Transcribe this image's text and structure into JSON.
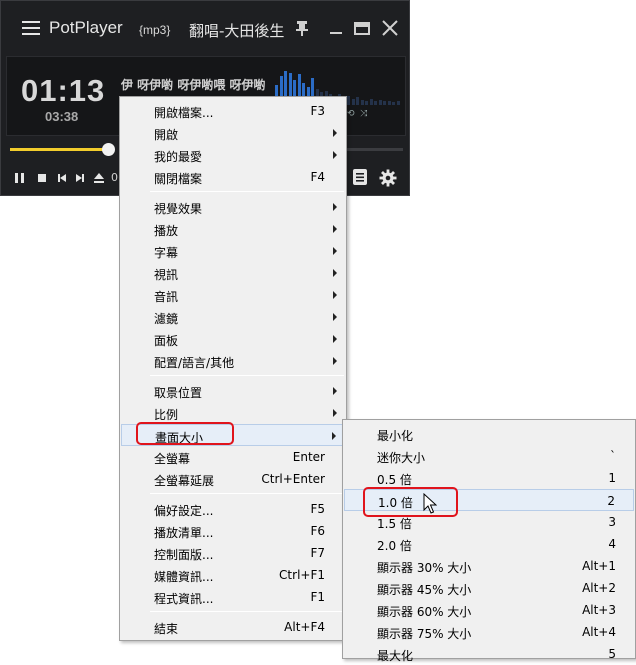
{
  "player": {
    "app_title": "PotPlayer",
    "file_format": "{mp3}",
    "file_title": "翻唱-大田後生",
    "time_current": "01:13",
    "time_total": "03:38",
    "lyrics": "伊 呀伊喲 呀伊喲喂 呀伊喲",
    "partial_text": "0(",
    "accent_color": "#f2cc2c",
    "spectrum_color": "#2b6cc6",
    "seek_progress": 0.25
  },
  "main_menu": {
    "items": [
      {
        "label": "開啟檔案...",
        "shortcut": "F3",
        "submenu": false
      },
      {
        "label": "開啟",
        "shortcut": "",
        "submenu": true
      },
      {
        "label": "我的最愛",
        "shortcut": "",
        "submenu": true
      },
      {
        "label": "關閉檔案",
        "shortcut": "F4",
        "submenu": false
      },
      {
        "sep": true
      },
      {
        "label": "視覺效果",
        "shortcut": "",
        "submenu": true
      },
      {
        "label": "播放",
        "shortcut": "",
        "submenu": true
      },
      {
        "label": "字幕",
        "shortcut": "",
        "submenu": true
      },
      {
        "label": "視訊",
        "shortcut": "",
        "submenu": true
      },
      {
        "label": "音訊",
        "shortcut": "",
        "submenu": true
      },
      {
        "label": "濾鏡",
        "shortcut": "",
        "submenu": true
      },
      {
        "label": "面板",
        "shortcut": "",
        "submenu": true
      },
      {
        "label": "配置/語言/其他",
        "shortcut": "",
        "submenu": true
      },
      {
        "sep": true
      },
      {
        "label": "取景位置",
        "shortcut": "",
        "submenu": true
      },
      {
        "label": "比例",
        "shortcut": "",
        "submenu": true
      },
      {
        "label": "畫面大小",
        "shortcut": "",
        "submenu": true,
        "highlighted": true
      },
      {
        "label": "全螢幕",
        "shortcut": "Enter",
        "submenu": false
      },
      {
        "label": "全螢幕延展",
        "shortcut": "Ctrl+Enter",
        "submenu": false
      },
      {
        "sep": true
      },
      {
        "label": "偏好設定...",
        "shortcut": "F5",
        "submenu": false
      },
      {
        "label": "播放清單...",
        "shortcut": "F6",
        "submenu": false
      },
      {
        "label": "控制面版...",
        "shortcut": "F7",
        "submenu": false
      },
      {
        "label": "媒體資訊...",
        "shortcut": "Ctrl+F1",
        "submenu": false
      },
      {
        "label": "程式資訊...",
        "shortcut": "F1",
        "submenu": false
      },
      {
        "sep": true
      },
      {
        "label": "結束",
        "shortcut": "Alt+F4",
        "submenu": false
      }
    ]
  },
  "size_menu": {
    "items": [
      {
        "label": "最小化",
        "shortcut": ""
      },
      {
        "label": "迷你大小",
        "shortcut": "`"
      },
      {
        "label": "0.5 倍",
        "shortcut": "1"
      },
      {
        "label": "1.0 倍",
        "shortcut": "2",
        "highlighted": true
      },
      {
        "label": "1.5 倍",
        "shortcut": "3"
      },
      {
        "label": "2.0 倍",
        "shortcut": "4"
      },
      {
        "label": "顯示器 30% 大小",
        "shortcut": "Alt+1"
      },
      {
        "label": "顯示器 45% 大小",
        "shortcut": "Alt+2"
      },
      {
        "label": "顯示器 60% 大小",
        "shortcut": "Alt+3"
      },
      {
        "label": "顯示器 75% 大小",
        "shortcut": "Alt+4"
      },
      {
        "label": "最大化",
        "shortcut": "5"
      }
    ]
  },
  "icons": {
    "menu": "hamburger-menu-icon",
    "pin": "pin-icon",
    "minimize": "minimize-icon",
    "maximize": "maximize-icon",
    "close": "close-icon",
    "play_pause": "pause-icon",
    "stop": "stop-icon",
    "prev": "previous-icon",
    "next": "next-icon",
    "eject": "eject-icon",
    "playlist": "playlist-icon",
    "settings": "gear-icon",
    "cursor": "mouse-pointer-icon"
  }
}
